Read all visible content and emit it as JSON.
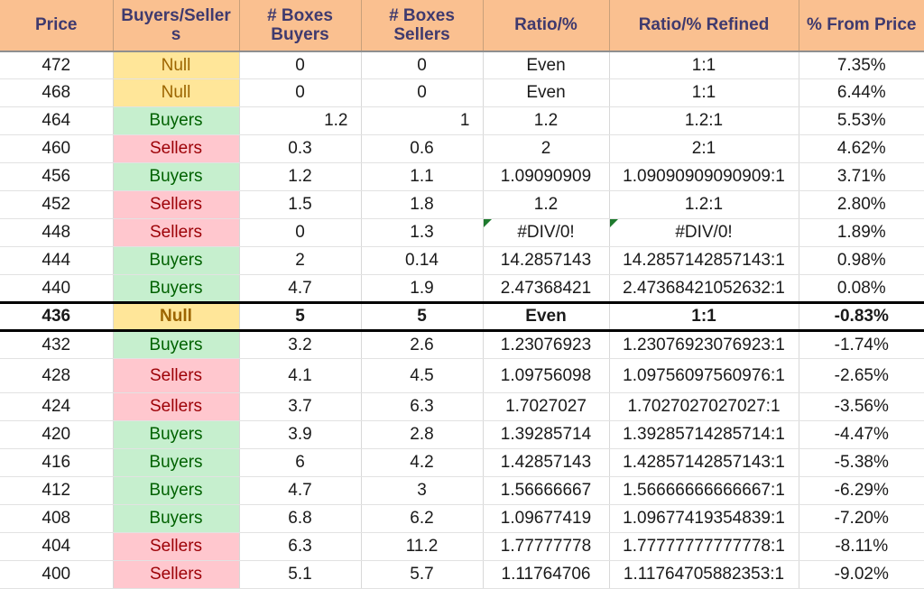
{
  "table": {
    "columns": [
      {
        "key": "price",
        "label": "Price"
      },
      {
        "key": "bs",
        "label": "Buyers/Sellers"
      },
      {
        "key": "box_buyers",
        "label": "# Boxes Buyers"
      },
      {
        "key": "box_sellers",
        "label": "# Boxes Sellers"
      },
      {
        "key": "ratio",
        "label": "Ratio/%"
      },
      {
        "key": "ratio_ref",
        "label": "Ratio/% Refined"
      },
      {
        "key": "pct",
        "label": "% From Price"
      }
    ],
    "colors": {
      "header_bg": "#FAC090",
      "header_text": "#3F3A6E",
      "null_bg": "#FFE699",
      "null_text": "#9C6500",
      "buyers_bg": "#C6EFCE",
      "buyers_text": "#006100",
      "sellers_bg": "#FFC7CE",
      "sellers_text": "#9C0006",
      "grid_line": "#D8D8D8",
      "emphasis_border": "#000000",
      "error_marker": "#1E7A2E"
    },
    "rows": [
      {
        "price": "472",
        "bs": "Null",
        "box_buyers": "0",
        "box_sellers": "0",
        "ratio": "Even",
        "ratio_ref": "1:1",
        "pct": "7.35%"
      },
      {
        "price": "468",
        "bs": "Null",
        "box_buyers": "0",
        "box_sellers": "0",
        "ratio": "Even",
        "ratio_ref": "1:1",
        "pct": "6.44%"
      },
      {
        "price": "464",
        "bs": "Buyers",
        "box_buyers": "1.2",
        "box_sellers": "1",
        "ratio": "1.2",
        "ratio_ref": "1.2:1",
        "pct": "5.53%"
      },
      {
        "price": "460",
        "bs": "Sellers",
        "box_buyers": "0.3",
        "box_sellers": "0.6",
        "ratio": "2",
        "ratio_ref": "2:1",
        "pct": "4.62%"
      },
      {
        "price": "456",
        "bs": "Buyers",
        "box_buyers": "1.2",
        "box_sellers": "1.1",
        "ratio": "1.09090909",
        "ratio_ref": "1.09090909090909:1",
        "pct": "3.71%"
      },
      {
        "price": "452",
        "bs": "Sellers",
        "box_buyers": "1.5",
        "box_sellers": "1.8",
        "ratio": "1.2",
        "ratio_ref": "1.2:1",
        "pct": "2.80%"
      },
      {
        "price": "448",
        "bs": "Sellers",
        "box_buyers": "0",
        "box_sellers": "1.3",
        "ratio": "#DIV/0!",
        "ratio_ref": "#DIV/0!",
        "pct": "1.89%"
      },
      {
        "price": "444",
        "bs": "Buyers",
        "box_buyers": "2",
        "box_sellers": "0.14",
        "ratio": "14.2857143",
        "ratio_ref": "14.2857142857143:1",
        "pct": "0.98%"
      },
      {
        "price": "440",
        "bs": "Buyers",
        "box_buyers": "4.7",
        "box_sellers": "1.9",
        "ratio": "2.47368421",
        "ratio_ref": "2.47368421052632:1",
        "pct": "0.08%"
      },
      {
        "price": "436",
        "bs": "Null",
        "box_buyers": "5",
        "box_sellers": "5",
        "ratio": "Even",
        "ratio_ref": "1:1",
        "pct": "-0.83%"
      },
      {
        "price": "432",
        "bs": "Buyers",
        "box_buyers": "3.2",
        "box_sellers": "2.6",
        "ratio": "1.23076923",
        "ratio_ref": "1.23076923076923:1",
        "pct": "-1.74%"
      },
      {
        "price": "428",
        "bs": "Sellers",
        "box_buyers": "4.1",
        "box_sellers": "4.5",
        "ratio": "1.09756098",
        "ratio_ref": "1.09756097560976:1",
        "pct": "-2.65%"
      },
      {
        "price": "424",
        "bs": "Sellers",
        "box_buyers": "3.7",
        "box_sellers": "6.3",
        "ratio": "1.7027027",
        "ratio_ref": "1.7027027027027:1",
        "pct": "-3.56%"
      },
      {
        "price": "420",
        "bs": "Buyers",
        "box_buyers": "3.9",
        "box_sellers": "2.8",
        "ratio": "1.39285714",
        "ratio_ref": "1.39285714285714:1",
        "pct": "-4.47%"
      },
      {
        "price": "416",
        "bs": "Buyers",
        "box_buyers": "6",
        "box_sellers": "4.2",
        "ratio": "1.42857143",
        "ratio_ref": "1.42857142857143:1",
        "pct": "-5.38%"
      },
      {
        "price": "412",
        "bs": "Buyers",
        "box_buyers": "4.7",
        "box_sellers": "3",
        "ratio": "1.56666667",
        "ratio_ref": "1.56666666666667:1",
        "pct": "-6.29%"
      },
      {
        "price": "408",
        "bs": "Buyers",
        "box_buyers": "6.8",
        "box_sellers": "6.2",
        "ratio": "1.09677419",
        "ratio_ref": "1.09677419354839:1",
        "pct": "-7.20%"
      },
      {
        "price": "404",
        "bs": "Sellers",
        "box_buyers": "6.3",
        "box_sellers": "11.2",
        "ratio": "1.77777778",
        "ratio_ref": "1.77777777777778:1",
        "pct": "-8.11%"
      },
      {
        "price": "400",
        "bs": "Sellers",
        "box_buyers": "5.1",
        "box_sellers": "5.7",
        "ratio": "1.11764706",
        "ratio_ref": "1.11764705882353:1",
        "pct": "-9.02%"
      }
    ]
  }
}
